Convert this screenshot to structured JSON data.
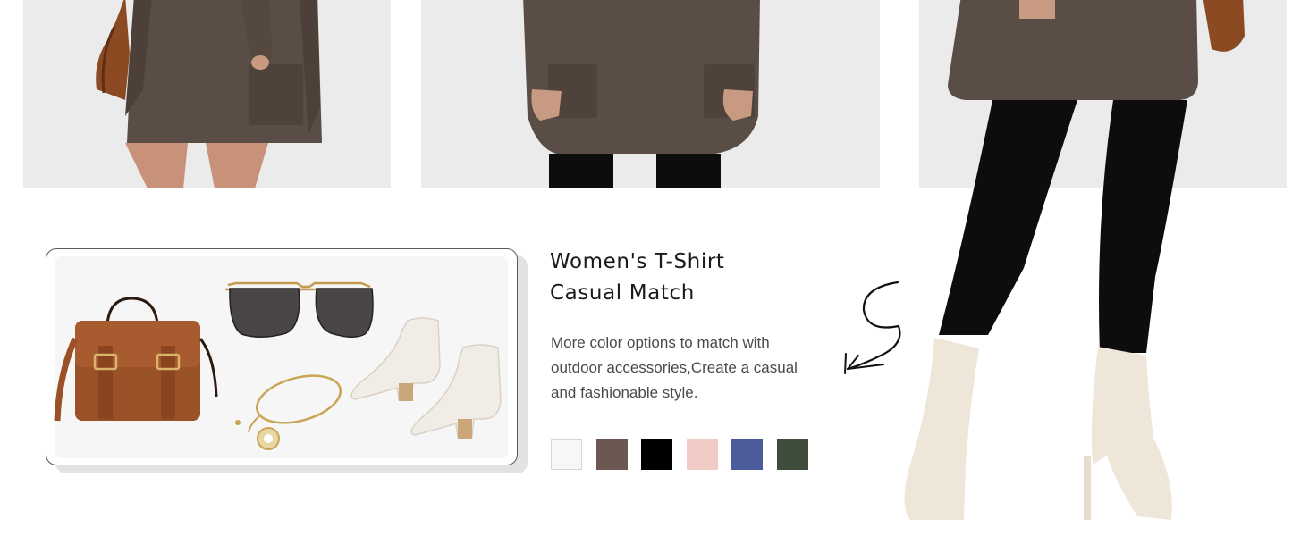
{
  "heading": {
    "line1": "Women's T-Shirt",
    "line2": "Casual Match"
  },
  "description": {
    "line1": "More color options to match with",
    "line2": "outdoor accessories,Create a casual",
    "line3": "and fashionable style."
  },
  "color_swatches": [
    {
      "name": "white",
      "hex": "#f7f7f7"
    },
    {
      "name": "brown",
      "hex": "#6b5852"
    },
    {
      "name": "black",
      "hex": "#000000"
    },
    {
      "name": "pink",
      "hex": "#f1cbc6"
    },
    {
      "name": "blue",
      "hex": "#4b5b9c"
    },
    {
      "name": "green",
      "hex": "#3f4d3b"
    }
  ],
  "colors": {
    "panel_background": "#ebebeb",
    "sweater": "#5a4d45",
    "leggings": "#0d0d0d",
    "boots": "#ede6d9",
    "handbag": "#9a5128"
  },
  "accessories": [
    "handbag-icon",
    "sunglasses-icon",
    "bracelet-icon",
    "ankle-boots-icon"
  ]
}
